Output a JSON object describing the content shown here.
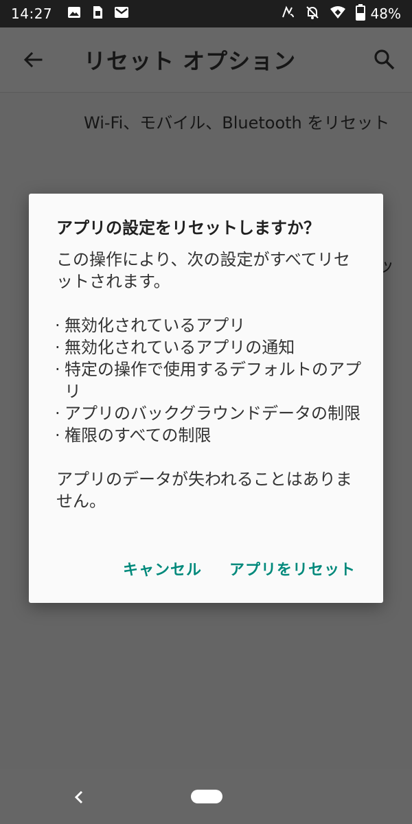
{
  "status_bar": {
    "time": "14:27",
    "battery_percent": "48%",
    "left_icons": [
      "image-icon",
      "sim-card-icon",
      "gmail-icon"
    ],
    "right_icons": [
      "nfc-icon",
      "notifications-off-icon",
      "wifi-icon",
      "battery-icon"
    ]
  },
  "app_bar": {
    "title": "リセット オプション",
    "back_icon": "arrow-back-icon",
    "search_icon": "search-icon"
  },
  "list": {
    "items": [
      {
        "label": "Wi-Fi、モバイル、Bluetooth をリセット"
      },
      {
        "label": "ッ"
      }
    ]
  },
  "dialog": {
    "title": "アプリの設定をリセットしますか？",
    "intro": "この操作により、次の設定がすべてリセットされます。",
    "bullets": [
      "無効化されているアプリ",
      "無効化されているアプリの通知",
      "特定の操作で使用するデフォルトのアプリ",
      "アプリのバックグラウンドデータの制限",
      "権限のすべての制限"
    ],
    "note": "アプリのデータが失われることはありません。",
    "cancel_label": "キャンセル",
    "confirm_label": "アプリをリセット"
  },
  "colors": {
    "accent": "#00897b",
    "scrim_background": "#646464",
    "status_bar": "#1e1e1e",
    "dialog_background": "#fafafa"
  }
}
